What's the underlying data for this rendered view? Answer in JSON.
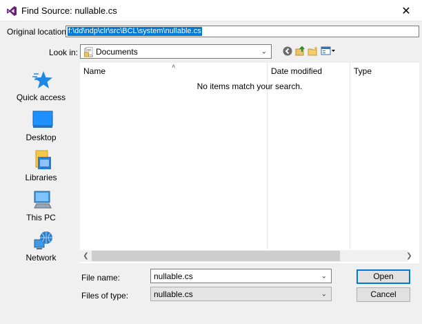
{
  "window": {
    "title": "Find Source: nullable.cs",
    "close_glyph": "✕",
    "app_icon": "visual-studio-icon"
  },
  "original_location": {
    "label": "Original location:",
    "value": "f:\\dd\\ndp\\clr\\src\\BCL\\system\\nullable.cs"
  },
  "look_in": {
    "label": "Look in:",
    "value": "Documents"
  },
  "toolbar": {
    "icons": [
      "back-icon",
      "up-folder-icon",
      "new-folder-icon",
      "view-menu-icon"
    ]
  },
  "places": [
    {
      "label": "Quick access",
      "icon": "quick-access-icon"
    },
    {
      "label": "Desktop",
      "icon": "desktop-icon"
    },
    {
      "label": "Libraries",
      "icon": "libraries-icon"
    },
    {
      "label": "This PC",
      "icon": "this-pc-icon"
    },
    {
      "label": "Network",
      "icon": "network-icon"
    }
  ],
  "file_list": {
    "columns": [
      "Name",
      "Date modified",
      "Type"
    ],
    "empty_message": "No items match your search."
  },
  "file_name": {
    "label": "File name:",
    "value": "nullable.cs"
  },
  "file_type": {
    "label": "Files of type:",
    "value": "nullable.cs"
  },
  "buttons": {
    "open": "Open",
    "cancel": "Cancel"
  },
  "colors": {
    "accent": "#0078d7",
    "vs_purple": "#68217a"
  }
}
